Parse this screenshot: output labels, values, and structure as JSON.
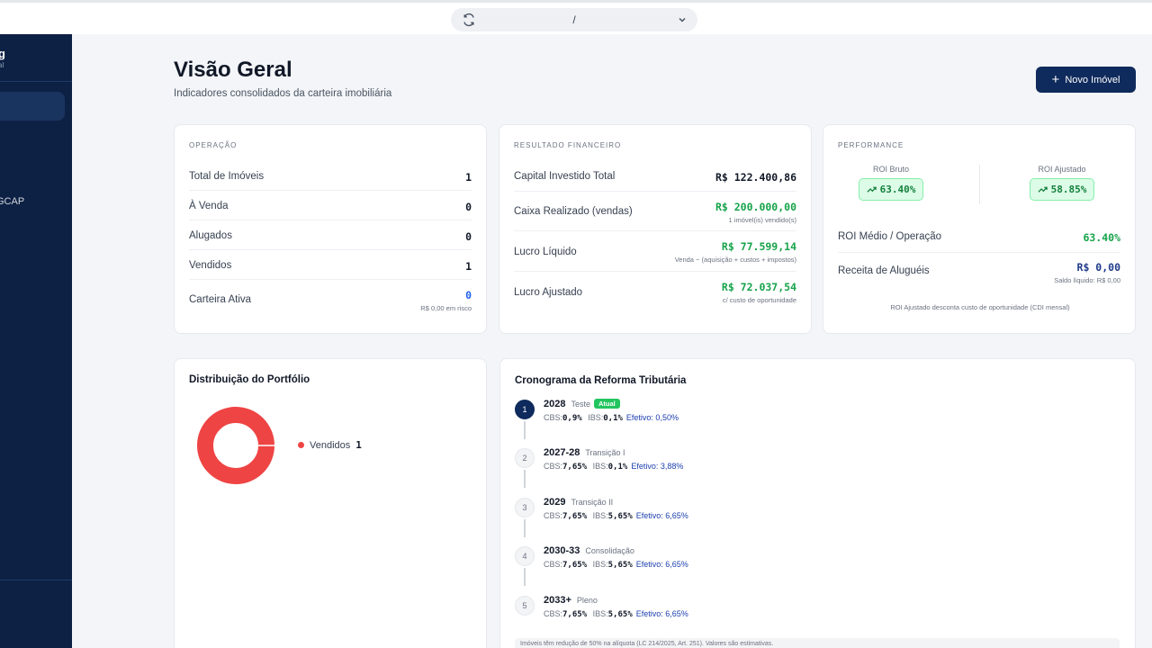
{
  "browser": {
    "url": "/"
  },
  "sidebar": {
    "brand": "g",
    "brand_sub": "al",
    "item": "GCAP"
  },
  "header": {
    "title": "Visão Geral",
    "subtitle": "Indicadores consolidados da carteira imobiliária",
    "new_button": "Novo Imóvel"
  },
  "operacao": {
    "label": "OPERAÇÃO",
    "rows": [
      {
        "label": "Total de Imóveis",
        "value": "1"
      },
      {
        "label": "À Venda",
        "value": "0"
      },
      {
        "label": "Alugados",
        "value": "0"
      },
      {
        "label": "Vendidos",
        "value": "1"
      },
      {
        "label": "Carteira Ativa",
        "value": "0",
        "sub": "R$ 0,00 em risco"
      }
    ]
  },
  "financeiro": {
    "label": "RESULTADO FINANCEIRO",
    "rows": [
      {
        "label": "Capital Investido Total",
        "value": "R$ 122.400,86"
      },
      {
        "label": "Caixa Realizado (vendas)",
        "value": "R$ 200.000,00",
        "sub": "1 imóvel(is) vendido(s)"
      },
      {
        "label": "Lucro Líquido",
        "value": "R$ 77.599,14",
        "sub": "Venda − (aquisição + custos + impostos)"
      },
      {
        "label": "Lucro Ajustado",
        "value": "R$ 72.037,54",
        "sub": "c/ custo de oportunidade"
      }
    ]
  },
  "performance": {
    "label": "PERFORMANCE",
    "roi_bruto_label": "ROI Bruto",
    "roi_bruto": "63.40%",
    "roi_ajustado_label": "ROI Ajustado",
    "roi_ajustado": "58.85%",
    "roi_medio_label": "ROI Médio / Operação",
    "roi_medio": "63.40%",
    "receita_label": "Receita de Aluguéis",
    "receita": "R$ 0,00",
    "receita_sub": "Saldo líquido: R$ 0,00",
    "note": "ROI Ajustado desconta custo de oportunidade (CDI mensal)"
  },
  "portfolio": {
    "title": "Distribuição do Portfólio",
    "legend": [
      {
        "name": "Vendidos",
        "count": "1",
        "color": "#ef4444"
      }
    ]
  },
  "chart_data": {
    "type": "pie",
    "categories": [
      "Vendidos"
    ],
    "values": [
      1
    ],
    "title": "Distribuição do Portfólio",
    "colors": [
      "#ef4444"
    ],
    "donut": true
  },
  "timeline": {
    "title": "Cronograma da Reforma Tributária",
    "items": [
      {
        "step": "1",
        "year": "2028",
        "phase": "Teste",
        "badge": "Atual",
        "cbs": "0,9%",
        "ibs": "0,1%",
        "efetivo": "Efetivo: 0,50%"
      },
      {
        "step": "2",
        "year": "2027-28",
        "phase": "Transição I",
        "cbs": "7,65%",
        "ibs": "0,1%",
        "efetivo": "Efetivo: 3,88%"
      },
      {
        "step": "3",
        "year": "2029",
        "phase": "Transição II",
        "cbs": "7,65%",
        "ibs": "5,65%",
        "efetivo": "Efetivo: 6,65%"
      },
      {
        "step": "4",
        "year": "2030-33",
        "phase": "Consolidação",
        "cbs": "7,65%",
        "ibs": "5,65%",
        "efetivo": "Efetivo: 6,65%"
      },
      {
        "step": "5",
        "year": "2033+",
        "phase": "Pleno",
        "cbs": "7,65%",
        "ibs": "5,65%",
        "efetivo": "Efetivo: 6,65%"
      }
    ],
    "cbs_label": "CBS:",
    "ibs_label": "IBS:",
    "footnote": "Imóveis têm redução de 50% na alíquota (LC 214/2025, Art. 251). Valores são estimativas."
  }
}
